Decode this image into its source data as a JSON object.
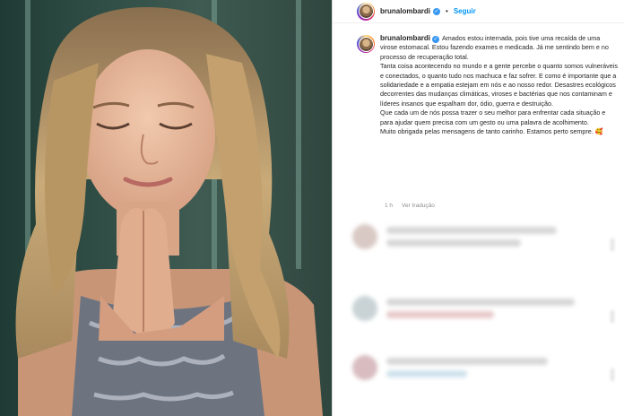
{
  "header": {
    "username": "brunalombardi",
    "verified_icon": "verified-badge-icon",
    "separator": "•",
    "follow_label": "Seguir"
  },
  "caption": {
    "username": "brunalombardi",
    "paragraphs": [
      "Amados estou internada, pois tive uma recaída de uma virose estomacal. Estou fazendo exames e medicada. Já me sentindo bem e no processo de recuperação total.",
      "Tanta coisa acontecendo no mundo e a gente percebe o quanto somos vulneráveis e conectados, o quanto tudo nos machuca e faz sofrer. E como é importante que a solidariedade e a empatia estejam em nós e ao nosso redor. Desastres ecológicos decorrentes das mudanças climáticas, viroses e bactérias que nos contaminam e líderes insanos que espalham dor, ódio, guerra e destruição.",
      "Que cada um de nós possa trazer o seu melhor para enfrentar cada situação e para ajudar quem precisa com um gesto ou uma palavra de acolhimento.",
      "Muito obrigada pelas mensagens de tanto carinho. Estamos perto sempre. 🥰"
    ]
  },
  "meta": {
    "time": "1 h",
    "translate_label": "Ver tradução"
  },
  "colors": {
    "link_blue": "#0095f6",
    "verified_blue": "#3897f0",
    "muted": "#8e8e8e"
  }
}
